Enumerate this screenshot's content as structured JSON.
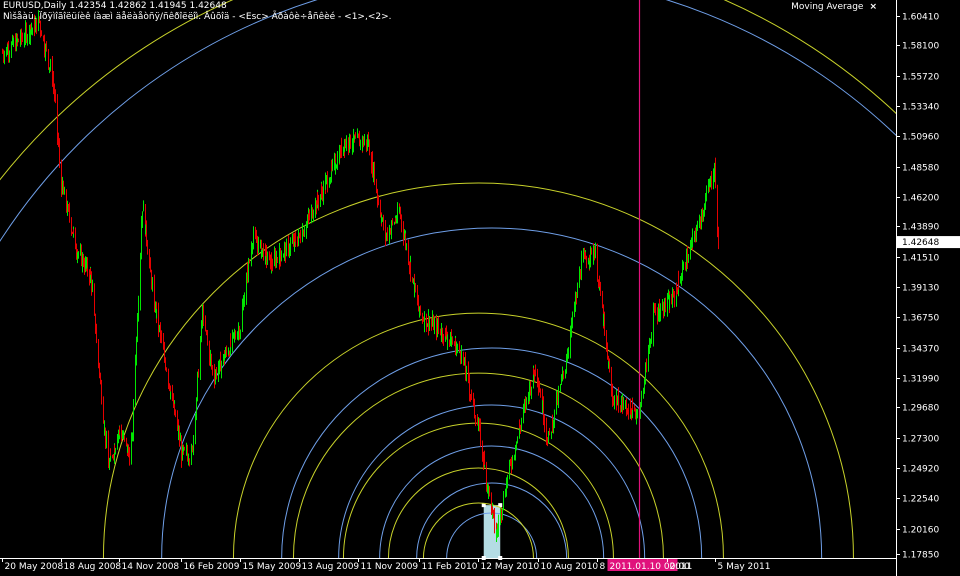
{
  "header": {
    "symbol_line": "EURUSD,Daily  1.42354 1.42862 1.41945 1.42648",
    "hint_line": "Nìšåàü. Ïðÿìîãîëüíèê íàæì äåëàåòñÿ/ñêðîëëîì. Âûõîä - <Esc> Ãðàôè÷åñêèé - <1>,<2>."
  },
  "indicator": {
    "label": "Moving Average",
    "close_label": "×"
  },
  "colors": {
    "bull": "#00e600",
    "bear": "#e60000",
    "blue_arc": "#6f9fe8",
    "yellow_arc": "#c8d22a",
    "vline": "#e0127c",
    "axis": "#ffffff"
  },
  "chart_data": {
    "type": "candlestick",
    "symbol": "EURUSD",
    "timeframe": "Daily",
    "last_price": 1.42648,
    "ylim": [
      1.1785,
      1.6165
    ],
    "y_ticks": [
      "1.60410",
      "1.58100",
      "1.55720",
      "1.53340",
      "1.50960",
      "1.48580",
      "1.46200",
      "1.43890",
      "1.41510",
      "1.39130",
      "1.36750",
      "1.34370",
      "1.31990",
      "1.29680",
      "1.27300",
      "1.24920",
      "1.22540",
      "1.20160",
      "1.17850"
    ],
    "y_tick_values": [
      1.6041,
      1.581,
      1.5572,
      1.5334,
      1.5096,
      1.4858,
      1.462,
      1.4389,
      1.4151,
      1.3913,
      1.3675,
      1.3437,
      1.3199,
      1.2968,
      1.273,
      1.2492,
      1.2254,
      1.2016,
      1.1785
    ],
    "x_ticks": [
      "20 May 2008",
      "18 Aug 2008",
      "14 Nov 2008",
      "16 Feb 2009",
      "15 May 2009",
      "13 Aug 2009",
      "11 Nov 2009",
      "11 Feb 2010",
      "12 May 2010",
      "10 Aug 2010",
      "8",
      "2011.01.10 00:00",
      "2011",
      "5 May 2011"
    ],
    "date_range": [
      "2008-05-20",
      "2011-05-10"
    ],
    "price_path": [
      [
        "2008-05-20",
        1.575
      ],
      [
        "2008-06-15",
        1.585
      ],
      [
        "2008-07-15",
        1.6
      ],
      [
        "2008-07-25",
        1.575
      ],
      [
        "2008-08-05",
        1.555
      ],
      [
        "2008-08-18",
        1.47
      ],
      [
        "2008-09-10",
        1.42
      ],
      [
        "2008-10-01",
        1.4
      ],
      [
        "2008-10-27",
        1.25
      ],
      [
        "2008-11-14",
        1.28
      ],
      [
        "2008-12-01",
        1.255
      ],
      [
        "2008-12-18",
        1.455
      ],
      [
        "2009-01-05",
        1.38
      ],
      [
        "2009-02-16",
        1.26
      ],
      [
        "2009-03-04",
        1.26
      ],
      [
        "2009-03-19",
        1.37
      ],
      [
        "2009-04-05",
        1.32
      ],
      [
        "2009-05-15",
        1.36
      ],
      [
        "2009-06-03",
        1.43
      ],
      [
        "2009-07-01",
        1.41
      ],
      [
        "2009-08-13",
        1.43
      ],
      [
        "2009-09-20",
        1.47
      ],
      [
        "2009-10-21",
        1.505
      ],
      [
        "2009-11-25",
        1.505
      ],
      [
        "2009-12-21",
        1.43
      ],
      [
        "2010-01-12",
        1.45
      ],
      [
        "2010-02-11",
        1.37
      ],
      [
        "2010-03-20",
        1.355
      ],
      [
        "2010-04-15",
        1.34
      ],
      [
        "2010-05-12",
        1.28
      ],
      [
        "2010-06-07",
        1.195
      ],
      [
        "2010-06-20",
        1.23
      ],
      [
        "2010-07-10",
        1.275
      ],
      [
        "2010-08-06",
        1.33
      ],
      [
        "2010-08-25",
        1.27
      ],
      [
        "2010-09-20",
        1.33
      ],
      [
        "2010-10-15",
        1.41
      ],
      [
        "2010-11-04",
        1.42
      ],
      [
        "2010-11-30",
        1.305
      ],
      [
        "2011-01-10",
        1.29
      ],
      [
        "2011-02-01",
        1.37
      ],
      [
        "2011-03-01",
        1.38
      ],
      [
        "2011-04-10",
        1.44
      ],
      [
        "2011-05-04",
        1.485
      ],
      [
        "2011-05-10",
        1.426
      ]
    ],
    "vertical_line_date": "2011.01.10 00:00",
    "selection_box": {
      "from": "2010-05-20",
      "to": "2010-06-14",
      "low": 1.1785,
      "high": 1.22
    },
    "fibo_arcs_blue_center": {
      "date": "2010-06-01",
      "price": 1.1785
    },
    "fibo_arcs_yellow_center": {
      "date": "2010-05-12",
      "price": 1.1785
    }
  }
}
